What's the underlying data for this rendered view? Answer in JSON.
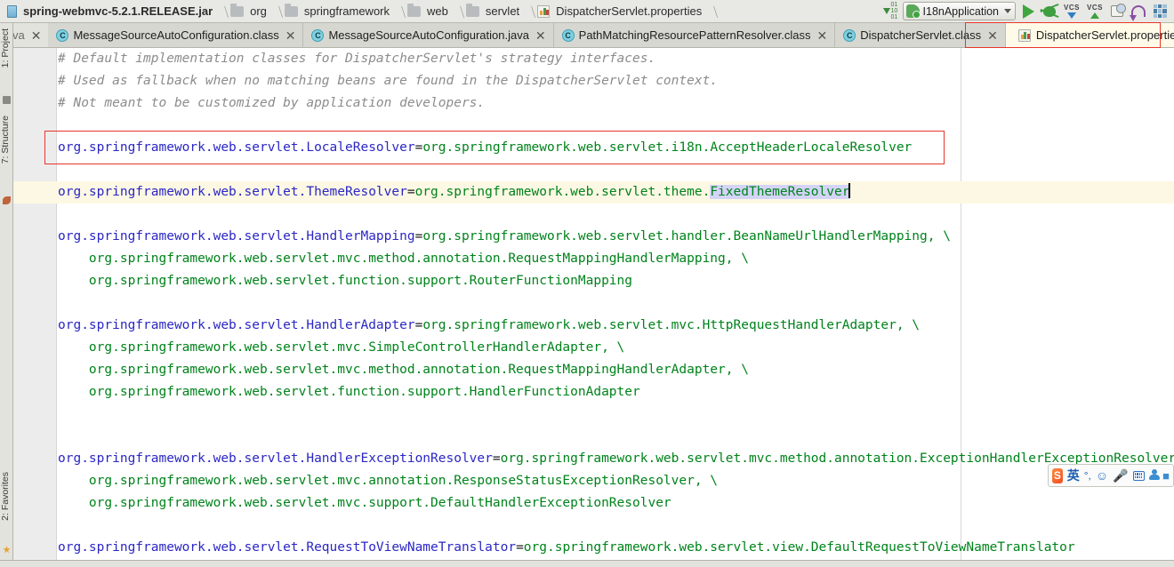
{
  "window": {
    "breadcrumb": [
      {
        "label": "spring-webmvc-5.2.1.RELEASE.jar",
        "icon": "jar-icon"
      },
      {
        "label": "org",
        "icon": "folder-icon"
      },
      {
        "label": "springframework",
        "icon": "folder-icon"
      },
      {
        "label": "web",
        "icon": "folder-icon"
      },
      {
        "label": "servlet",
        "icon": "folder-icon"
      },
      {
        "label": "DispatcherServlet.properties",
        "icon": "properties-file-icon"
      }
    ]
  },
  "toolbar": {
    "sort_icon": "sort-numeric-icon",
    "run_configuration": "I18nApplication",
    "run_label": "Run",
    "debug_label": "Debug",
    "vcs_update_label": "VCS",
    "vcs_commit_label": "VCS",
    "copy_label": "Copy",
    "undo_label": "Undo",
    "layout_label": "Layout"
  },
  "tabs": [
    {
      "label": "va",
      "icon": "java-file-icon",
      "active": false,
      "clipped": true
    },
    {
      "label": "MessageSourceAutoConfiguration.class",
      "icon": "class-file-icon",
      "active": false
    },
    {
      "label": "MessageSourceAutoConfiguration.java",
      "icon": "class-file-icon",
      "active": false
    },
    {
      "label": "PathMatchingResourcePatternResolver.class",
      "icon": "class-file-icon",
      "active": false
    },
    {
      "label": "DispatcherServlet.class",
      "icon": "class-file-icon",
      "active": false
    },
    {
      "label": "DispatcherServlet.properties",
      "icon": "properties-file-icon",
      "active": true
    }
  ],
  "left_tool_window": [
    {
      "label": "1: Project"
    },
    {
      "label": "7: Structure"
    },
    {
      "label": "2: Favorites"
    }
  ],
  "editor": {
    "selection": "FixedThemeResolver",
    "lines": [
      {
        "type": "comment",
        "text": "# Default implementation classes for DispatcherServlet's strategy interfaces."
      },
      {
        "type": "comment",
        "text": "# Used as fallback when no matching beans are found in the DispatcherServlet context."
      },
      {
        "type": "comment",
        "text": "# Not meant to be customized by application developers."
      },
      {
        "type": "blank",
        "text": ""
      },
      {
        "type": "pair",
        "key": "org.springframework.web.servlet.LocaleResolver",
        "value": "org.springframework.web.servlet.i18n.AcceptHeaderLocaleResolver",
        "boxed": true
      },
      {
        "type": "blank",
        "text": ""
      },
      {
        "type": "pair",
        "key": "org.springframework.web.servlet.ThemeResolver",
        "value": "org.springframework.web.servlet.theme.",
        "selected_value": "FixedThemeResolver",
        "current": true
      },
      {
        "type": "blank",
        "text": ""
      },
      {
        "type": "pair",
        "key": "org.springframework.web.servlet.HandlerMapping",
        "value": "org.springframework.web.servlet.handler.BeanNameUrlHandlerMapping, \\"
      },
      {
        "type": "cont",
        "text": "    org.springframework.web.servlet.mvc.method.annotation.RequestMappingHandlerMapping, \\"
      },
      {
        "type": "cont",
        "text": "    org.springframework.web.servlet.function.support.RouterFunctionMapping"
      },
      {
        "type": "blank",
        "text": ""
      },
      {
        "type": "pair",
        "key": "org.springframework.web.servlet.HandlerAdapter",
        "value": "org.springframework.web.servlet.mvc.HttpRequestHandlerAdapter, \\"
      },
      {
        "type": "cont",
        "text": "    org.springframework.web.servlet.mvc.SimpleControllerHandlerAdapter, \\"
      },
      {
        "type": "cont",
        "text": "    org.springframework.web.servlet.mvc.method.annotation.RequestMappingHandlerAdapter, \\"
      },
      {
        "type": "cont",
        "text": "    org.springframework.web.servlet.function.support.HandlerFunctionAdapter"
      },
      {
        "type": "blank",
        "text": ""
      },
      {
        "type": "blank",
        "text": ""
      },
      {
        "type": "pair",
        "key": "org.springframework.web.servlet.HandlerExceptionResolver",
        "value": "org.springframework.web.servlet.mvc.method.annotation.ExceptionHandlerExceptionResolver, \\"
      },
      {
        "type": "cont",
        "text": "    org.springframework.web.servlet.mvc.annotation.ResponseStatusExceptionResolver, \\"
      },
      {
        "type": "cont",
        "text": "    org.springframework.web.servlet.mvc.support.DefaultHandlerExceptionResolver"
      },
      {
        "type": "blank",
        "text": ""
      },
      {
        "type": "pair",
        "key": "org.springframework.web.servlet.RequestToViewNameTranslator",
        "value": "org.springframework.web.servlet.view.DefaultRequestToViewNameTranslator"
      }
    ]
  },
  "ime": {
    "logo": "sogou-logo-icon",
    "mode": "英",
    "punctuation": "°,",
    "emoji": "smiley-icon",
    "voice": "microphone-icon",
    "keyboard": "keyboard-icon",
    "user": "user-dictionary-icon",
    "extra": "toolbox-icon"
  },
  "colors": {
    "key": "#2b27c4",
    "value": "#00831b",
    "comment": "#8c8c8c",
    "selection": "#d4d4f7",
    "current_line": "#fdf8e4",
    "annotation": "#e8352a",
    "chrome": "#e3e3de"
  }
}
